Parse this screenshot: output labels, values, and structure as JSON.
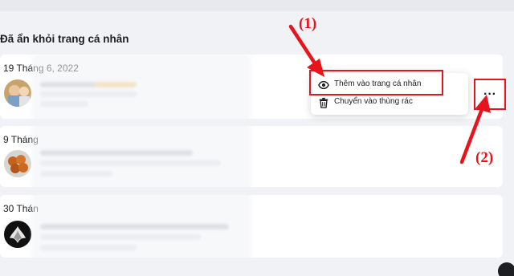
{
  "section_title": "Đã ẩn khỏi trang cá nhân",
  "posts": [
    {
      "date": "19 Tháng 6, 2022"
    },
    {
      "date": "9 Tháng"
    },
    {
      "date": "30 Thán"
    }
  ],
  "menu": {
    "items": [
      {
        "icon": "eye-icon",
        "label": "Thêm vào trang cá nhân"
      },
      {
        "icon": "trash-icon",
        "label": "Chuyển vào thùng rác"
      }
    ]
  },
  "more_button": {
    "label": "···"
  },
  "annotations": {
    "one": "(1)",
    "two": "(2)"
  },
  "colors": {
    "annotation": "#e8141b",
    "card": "#ffffff",
    "background": "#f0f2f5"
  }
}
